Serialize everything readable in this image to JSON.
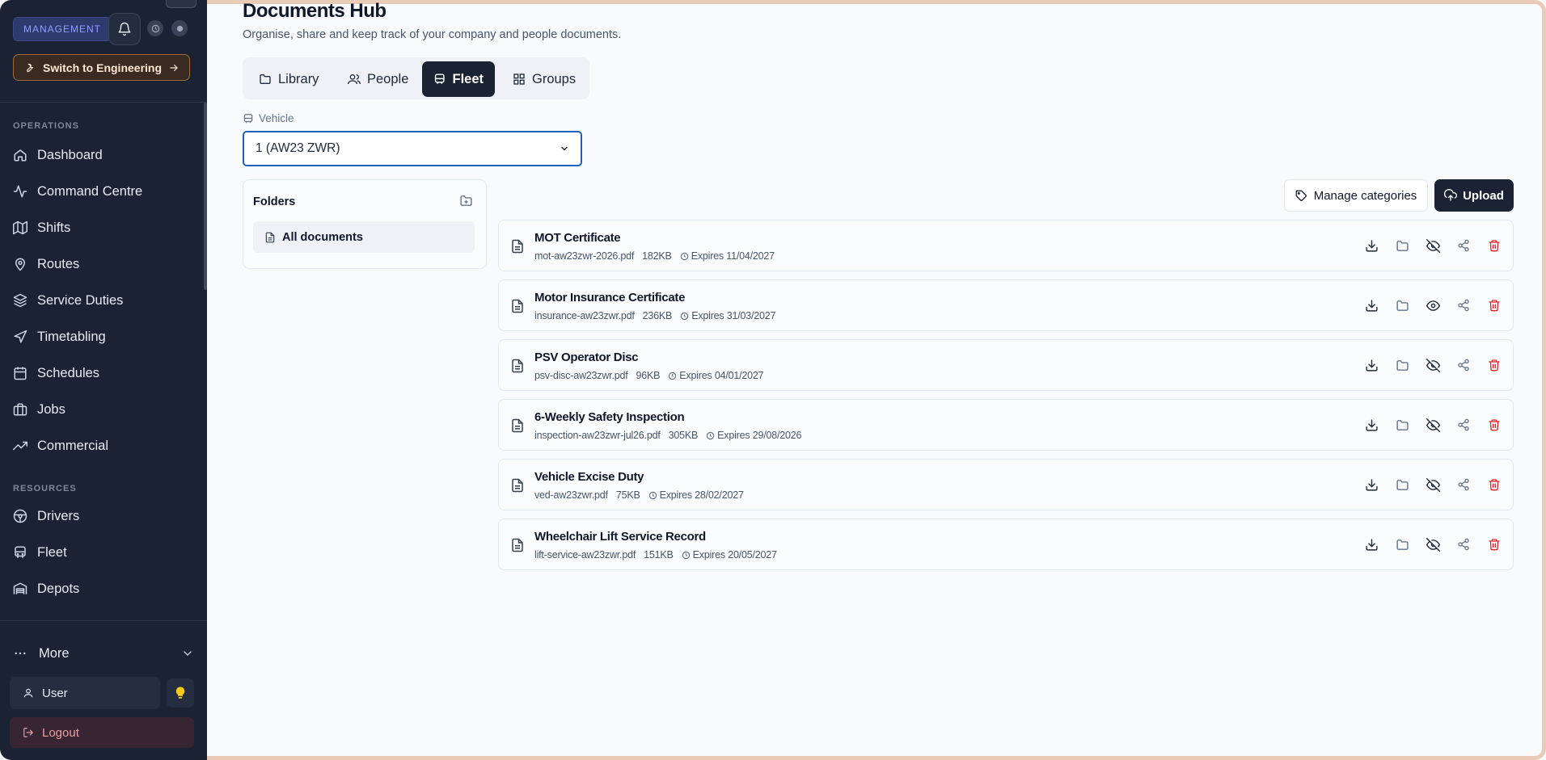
{
  "sidebar": {
    "badge": "MANAGEMENT",
    "switch_label": "Switch to Engineering",
    "sections": {
      "operations": "OPERATIONS",
      "resources": "RESOURCES"
    },
    "operations_items": [
      {
        "label": "Dashboard",
        "icon": "home-icon"
      },
      {
        "label": "Command Centre",
        "icon": "activity-icon"
      },
      {
        "label": "Shifts",
        "icon": "map-icon"
      },
      {
        "label": "Routes",
        "icon": "map-pin-icon"
      },
      {
        "label": "Service Duties",
        "icon": "layers-icon"
      },
      {
        "label": "Timetabling",
        "icon": "navigation-icon"
      },
      {
        "label": "Schedules",
        "icon": "calendar-icon"
      },
      {
        "label": "Jobs",
        "icon": "briefcase-icon"
      },
      {
        "label": "Commercial",
        "icon": "trending-up-icon"
      }
    ],
    "resources_items": [
      {
        "label": "Drivers",
        "icon": "steering-wheel-icon"
      },
      {
        "label": "Fleet",
        "icon": "bus-icon"
      },
      {
        "label": "Depots",
        "icon": "warehouse-icon"
      }
    ],
    "more_label": "More",
    "user_label": "User",
    "logout_label": "Logout"
  },
  "main": {
    "title": "Documents Hub",
    "subtitle": "Organise, share and keep track of your company and people documents.",
    "tabs": [
      {
        "label": "Library",
        "icon": "folder-icon",
        "active": false
      },
      {
        "label": "People",
        "icon": "users-icon",
        "active": false
      },
      {
        "label": "Fleet",
        "icon": "bus-icon",
        "active": true
      },
      {
        "label": "Groups",
        "icon": "grid-icon",
        "active": false
      }
    ],
    "vehicle_label": "Vehicle",
    "vehicle_selected": "1 (AW23 ZWR)",
    "folders_title": "Folders",
    "all_documents_label": "All documents",
    "manage_categories_label": "Manage categories",
    "upload_label": "Upload"
  },
  "documents": [
    {
      "title": "MOT Certificate",
      "file": "mot-aw23zwr-2026.pdf",
      "size": "182KB",
      "expires": "Expires 11/04/2027",
      "visible": false
    },
    {
      "title": "Motor Insurance Certificate",
      "file": "insurance-aw23zwr.pdf",
      "size": "236KB",
      "expires": "Expires 31/03/2027",
      "visible": true
    },
    {
      "title": "PSV Operator Disc",
      "file": "psv-disc-aw23zwr.pdf",
      "size": "96KB",
      "expires": "Expires 04/01/2027",
      "visible": false
    },
    {
      "title": "6-Weekly Safety Inspection",
      "file": "inspection-aw23zwr-jul26.pdf",
      "size": "305KB",
      "expires": "Expires 29/08/2026",
      "visible": false
    },
    {
      "title": "Vehicle Excise Duty",
      "file": "ved-aw23zwr.pdf",
      "size": "75KB",
      "expires": "Expires 28/02/2027",
      "visible": false
    },
    {
      "title": "Wheelchair Lift Service Record",
      "file": "lift-service-aw23zwr.pdf",
      "size": "151KB",
      "expires": "Expires 20/05/2027",
      "visible": false
    }
  ],
  "colors": {
    "sidebar_bg": "#1b2234",
    "accent_dark": "#1b2234",
    "delete_red": "#dc2626",
    "select_border": "#1f5fbf",
    "badge_text": "#8ea1ff"
  }
}
